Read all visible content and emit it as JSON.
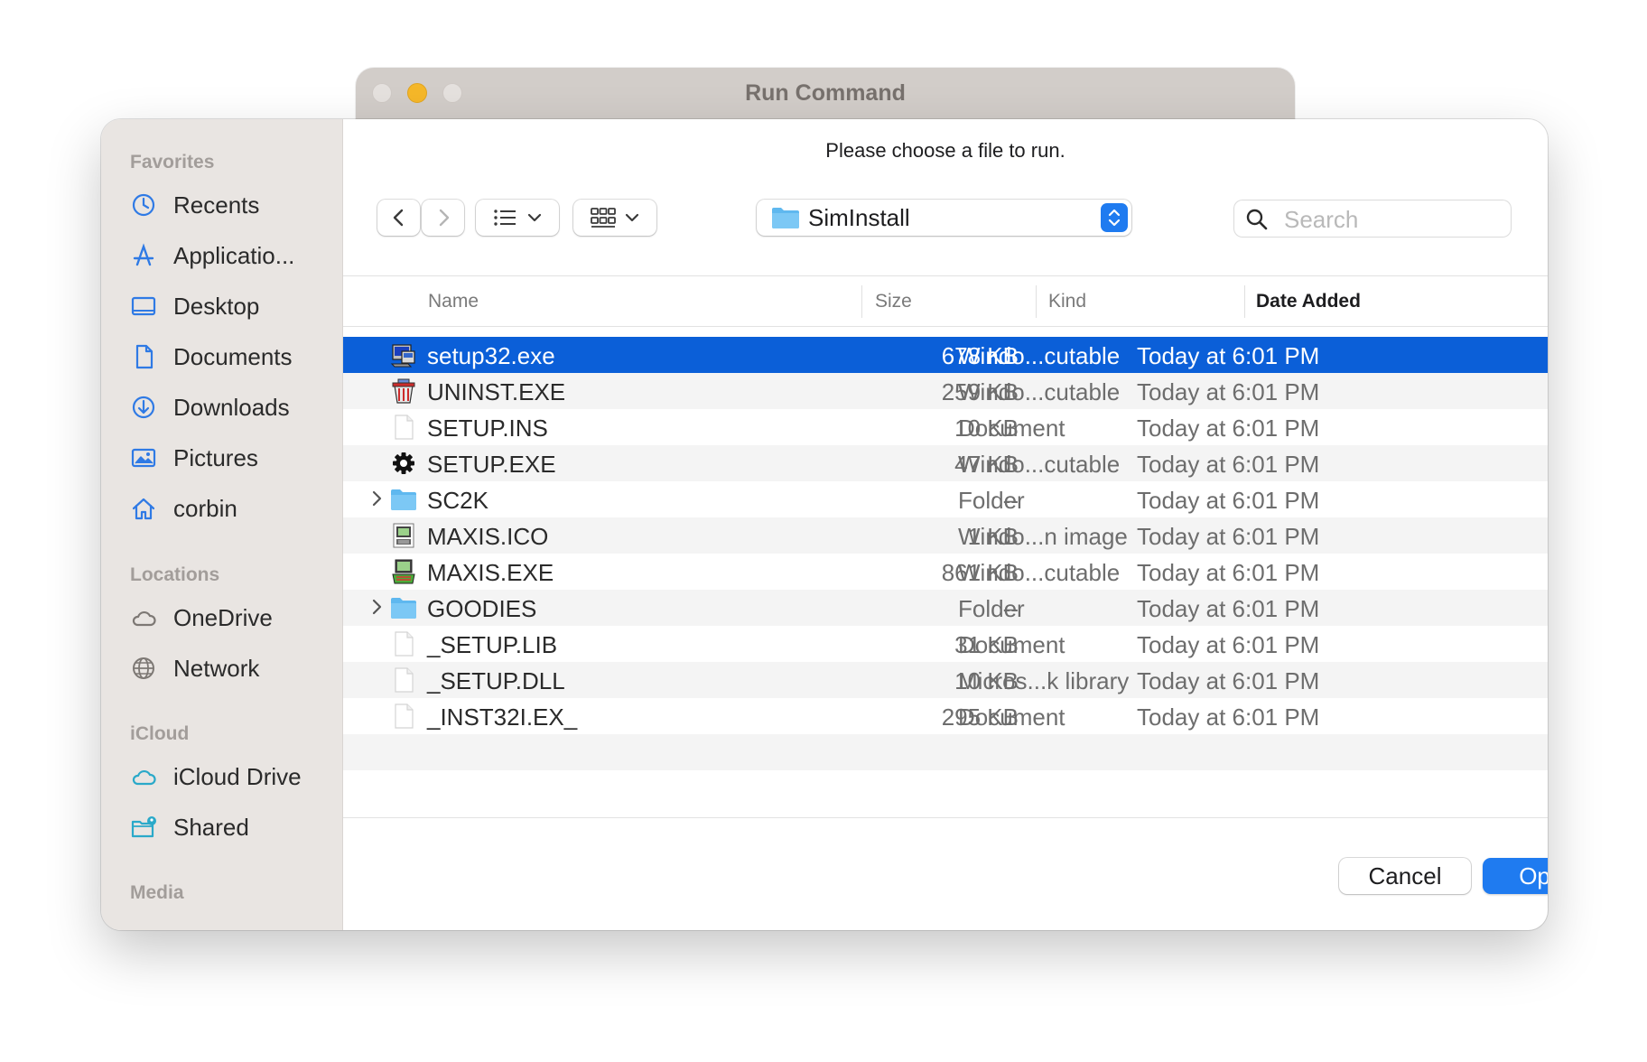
{
  "window": {
    "title": "Run Command"
  },
  "dialog": {
    "prompt": "Please choose a file to run."
  },
  "sidebar": {
    "sections": [
      {
        "heading": "Favorites",
        "items": [
          {
            "label": "Recents",
            "icon": "clock-icon"
          },
          {
            "label": "Applicatio...",
            "icon": "applications-icon"
          },
          {
            "label": "Desktop",
            "icon": "desktop-icon"
          },
          {
            "label": "Documents",
            "icon": "document-icon"
          },
          {
            "label": "Downloads",
            "icon": "download-icon"
          },
          {
            "label": "Pictures",
            "icon": "pictures-icon"
          },
          {
            "label": "corbin",
            "icon": "home-icon"
          }
        ]
      },
      {
        "heading": "Locations",
        "items": [
          {
            "label": "OneDrive",
            "icon": "cloud-icon"
          },
          {
            "label": "Network",
            "icon": "globe-icon"
          }
        ]
      },
      {
        "heading": "iCloud",
        "items": [
          {
            "label": "iCloud Drive",
            "icon": "icloud-icon"
          },
          {
            "label": "Shared",
            "icon": "shared-folder-icon"
          }
        ]
      },
      {
        "heading": "Media",
        "items": []
      }
    ]
  },
  "toolbar": {
    "current_folder": "SimInstall",
    "search_placeholder": "Search"
  },
  "columns": {
    "name": "Name",
    "size": "Size",
    "kind": "Kind",
    "date_added": "Date Added"
  },
  "files": [
    {
      "name": "setup32.exe",
      "size": "678 KB",
      "kind": "Windo...cutable",
      "date": "Today at 6:01 PM",
      "icon": "setup-exe-icon",
      "selected": true
    },
    {
      "name": "UNINST.EXE",
      "size": "259 KB",
      "kind": "Windo...cutable",
      "date": "Today at 6:01 PM",
      "icon": "uninstall-icon"
    },
    {
      "name": "SETUP.INS",
      "size": "10 KB",
      "kind": "Document",
      "date": "Today at 6:01 PM",
      "icon": "blank-document-icon"
    },
    {
      "name": "SETUP.EXE",
      "size": "47 KB",
      "kind": "Windo...cutable",
      "date": "Today at 6:01 PM",
      "icon": "gear-icon"
    },
    {
      "name": "SC2K",
      "size": "--",
      "kind": "Folder",
      "date": "Today at 6:01 PM",
      "icon": "folder-icon",
      "folder": true
    },
    {
      "name": "MAXIS.ICO",
      "size": "1 KB",
      "kind": "Windo...n image",
      "date": "Today at 6:01 PM",
      "icon": "maxis-ico-icon"
    },
    {
      "name": "MAXIS.EXE",
      "size": "861 KB",
      "kind": "Windo...cutable",
      "date": "Today at 6:01 PM",
      "icon": "maxis-exe-icon"
    },
    {
      "name": "GOODIES",
      "size": "--",
      "kind": "Folder",
      "date": "Today at 6:01 PM",
      "icon": "folder-icon",
      "folder": true
    },
    {
      "name": "_SETUP.LIB",
      "size": "31 KB",
      "kind": "Document",
      "date": "Today at 6:01 PM",
      "icon": "blank-document-icon"
    },
    {
      "name": "_SETUP.DLL",
      "size": "10 KB",
      "kind": "Micros...k library",
      "date": "Today at 6:01 PM",
      "icon": "blank-document-icon"
    },
    {
      "name": "_INST32I.EX_",
      "size": "295 KB",
      "kind": "Document",
      "date": "Today at 6:01 PM",
      "icon": "blank-document-icon"
    }
  ],
  "buttons": {
    "cancel": "Cancel",
    "open": "Open"
  },
  "colors": {
    "accent": "#1f7bf0",
    "selection": "#0b5fd8",
    "sidebar": "#e9e5e2"
  }
}
